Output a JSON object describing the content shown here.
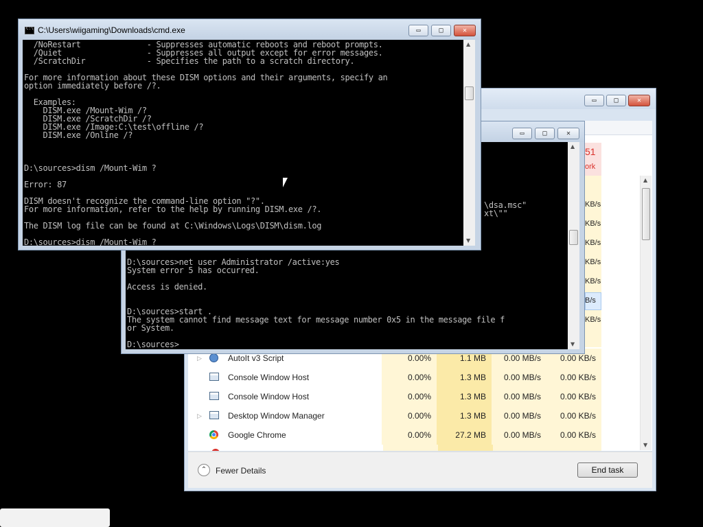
{
  "taskmanager": {
    "network_header_value": "51",
    "network_header_label": "ork",
    "side_net_values": [
      "KB/s",
      "KB/s",
      "KB/s",
      "KB/s",
      "KB/s",
      "KB/s",
      "KB/s"
    ],
    "selected_side_value": "B/s",
    "rows": [
      {
        "name": "AutoIt v3 Script",
        "icon": "autoit-icon",
        "expand": true,
        "cpu": "0.00%",
        "memory": "1.1 MB",
        "disk": "0.00 MB/s",
        "network": "0.00 KB/s"
      },
      {
        "name": "Console Window Host",
        "icon": "console-window-icon",
        "expand": false,
        "cpu": "0.00%",
        "memory": "1.3 MB",
        "disk": "0.00 MB/s",
        "network": "0.00 KB/s"
      },
      {
        "name": "Console Window Host",
        "icon": "console-window-icon",
        "expand": false,
        "cpu": "0.00%",
        "memory": "1.3 MB",
        "disk": "0.00 MB/s",
        "network": "0.00 KB/s"
      },
      {
        "name": "Desktop Window Manager",
        "icon": "console-window-icon",
        "expand": true,
        "cpu": "0.00%",
        "memory": "1.3 MB",
        "disk": "0.00 MB/s",
        "network": "0.00 KB/s"
      },
      {
        "name": "Google Chrome",
        "icon": "chrome-icon",
        "expand": false,
        "cpu": "0.00%",
        "memory": "27.2 MB",
        "disk": "0.00 MB/s",
        "network": "0.00 KB/s"
      }
    ],
    "fewer_details": "Fewer Details",
    "end_task": "End task"
  },
  "cmd_front": {
    "title": "C:\\Users\\wiigaming\\Downloads\\cmd.exe",
    "output": "  /NoRestart              - Suppresses automatic reboots and reboot prompts.\n  /Quiet                  - Suppresses all output except for error messages.\n  /ScratchDir             - Specifies the path to a scratch directory.\n\nFor more information about these DISM options and their arguments, specify an\noption immediately before /?.\n\n  Examples:\n    DISM.exe /Mount-Wim /?\n    DISM.exe /ScratchDir /?\n    DISM.exe /Image:C:\\test\\offline /?\n    DISM.exe /Online /?\n\n\n\nD:\\sources>dism /Mount-Wim ?\n\nError: 87\n\nDISM doesn't recognize the command-line option \"?\".\nFor more information, refer to the help by running DISM.exe /?.\n\nThe DISM log file can be found at C:\\Windows\\Logs\\DISM\\dism.log\n\nD:\\sources>dism /Mount-Wim ?"
  },
  "cmd_back": {
    "title": "",
    "peek_line1": "\\dsa.msc\"",
    "peek_line2": "xt\\\"\"",
    "output": "D:\\sources>net user Administrator /active:yes\nSystem error 5 has occurred.\n\nAccess is denied.\n\n\nD:\\sources>start .\nThe system cannot find message text for message number 0x5 in the message file f\nor System.\n\nD:\\sources>"
  }
}
